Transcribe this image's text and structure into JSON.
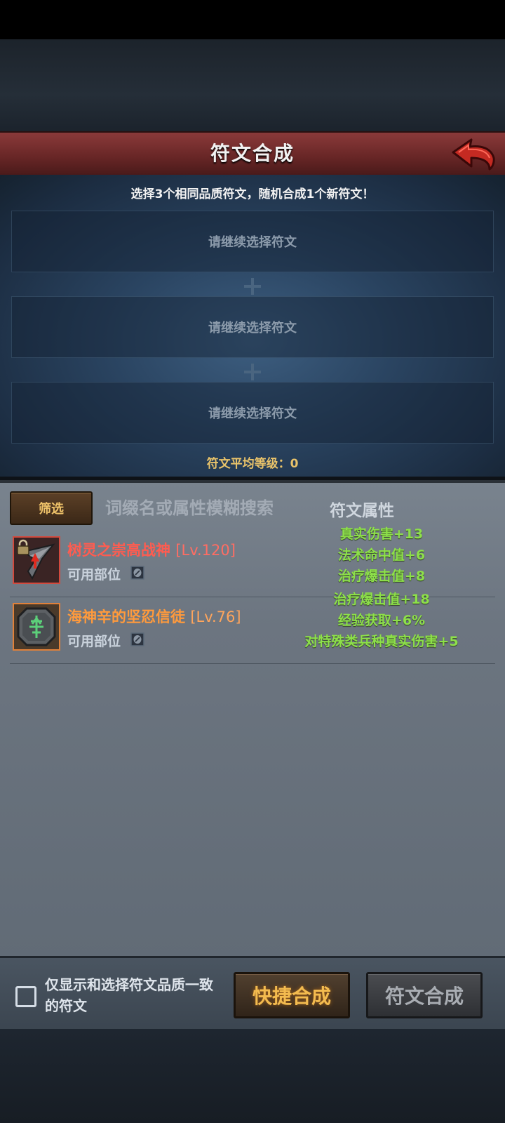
{
  "header": {
    "title": "符文合成"
  },
  "instruction": "选择3个相同品质符文，随机合成1个新符文！",
  "slots": [
    {
      "placeholder": "请继续选择符文"
    },
    {
      "placeholder": "请继续选择符文"
    },
    {
      "placeholder": "请继续选择符文"
    }
  ],
  "average_level": "符文平均等级：0",
  "filter": {
    "label": "筛选",
    "search_placeholder": "词缀名或属性模糊搜索",
    "attr_header": "符文属性"
  },
  "runes": [
    {
      "name": "树灵之崇高战神",
      "level": "[Lv.120]",
      "slot_label": "可用部位",
      "quality_color": "#d14a3e",
      "icon": "dagger-rune-icon",
      "locked": true,
      "attributes": [
        "真实伤害+13",
        "法术命中值+6",
        "治疗爆击值+8"
      ]
    },
    {
      "name": "海神辛的坚忍信徒",
      "level": "[Lv.76]",
      "slot_label": "可用部位",
      "quality_color": "#e0813a",
      "icon": "green-tree-rune-icon",
      "locked": false,
      "attributes": [
        "治疗爆击值+18",
        "经验获取+6%",
        "对特殊类兵种真实伤害+5"
      ]
    }
  ],
  "footer": {
    "checkbox_label": "仅显示和选择符文品质一致的符文",
    "quick_merge": "快捷合成",
    "merge": "符文合成"
  },
  "colors": {
    "attribute_green": "#8de04a",
    "accent_gold": "#f3bb4f",
    "header_red": "#6a2727"
  }
}
